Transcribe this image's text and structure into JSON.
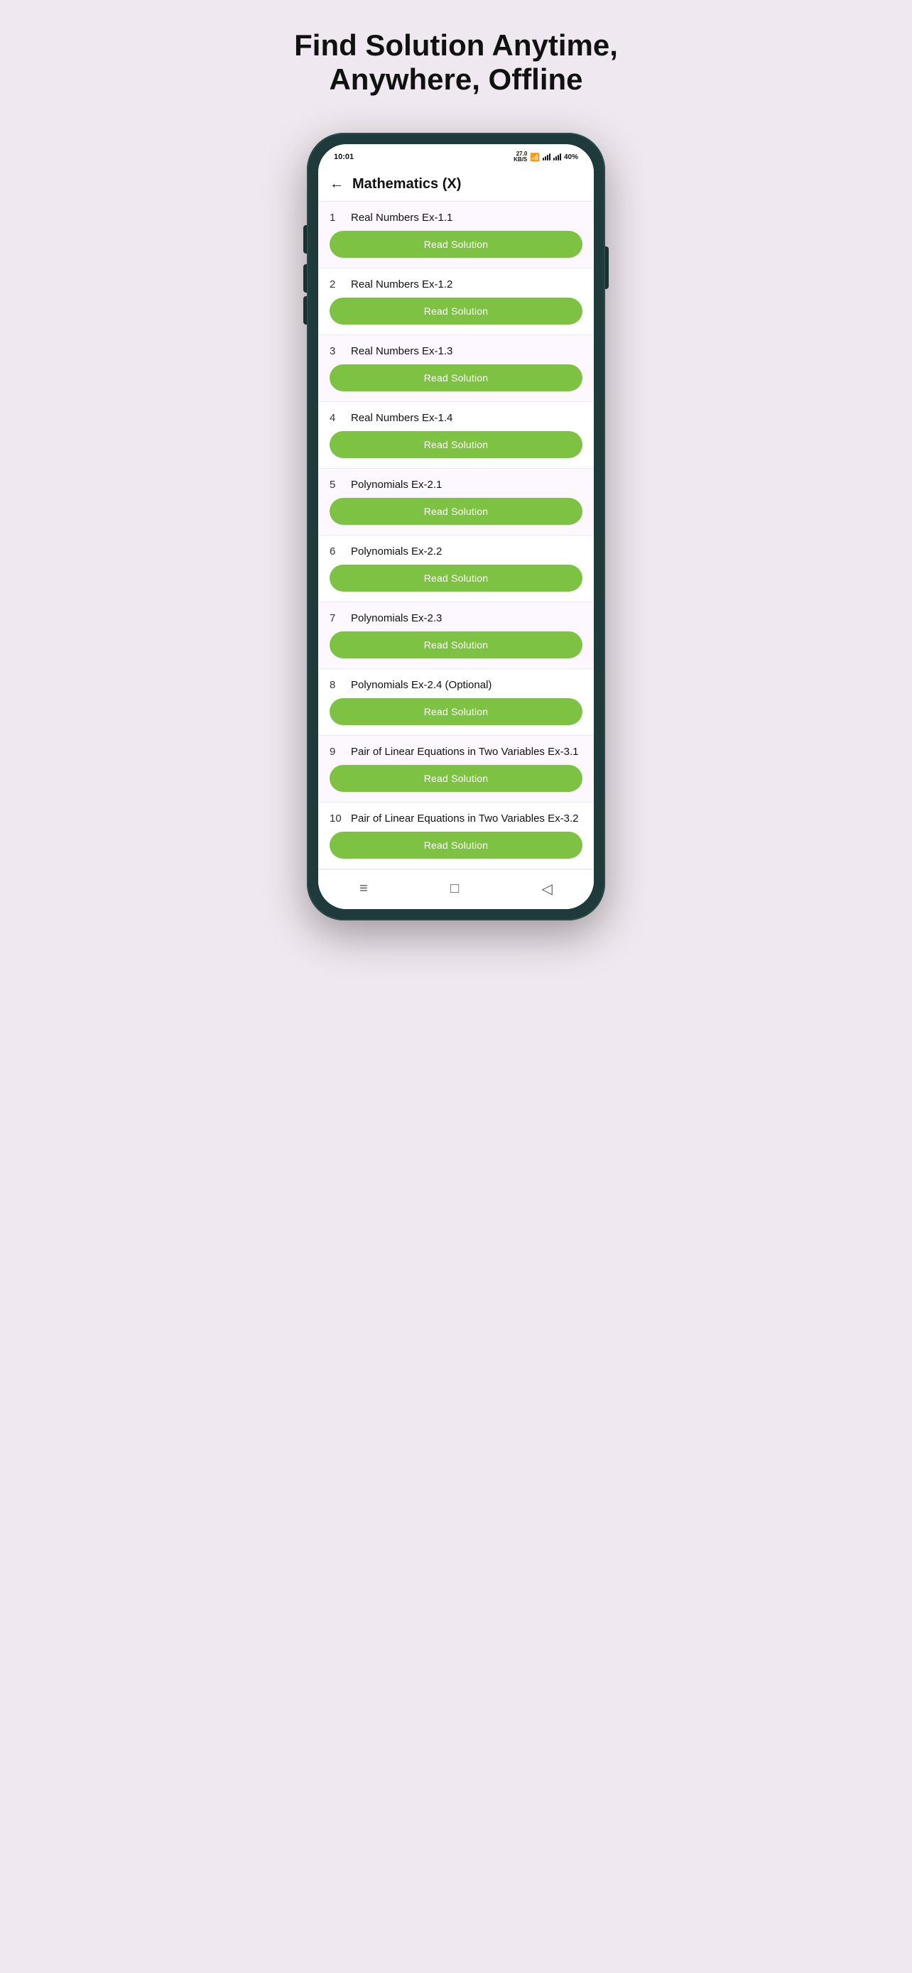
{
  "page": {
    "title_line1": "Find Solution Anytime,",
    "title_line2": "Anywhere, Offline"
  },
  "status_bar": {
    "time": "10:01",
    "kbs": "27.0\nKB/S",
    "battery": "40%"
  },
  "header": {
    "title": "Mathematics (X)"
  },
  "items": [
    {
      "number": "1",
      "name": "Real Numbers Ex-1.1",
      "btn": "Read Solution"
    },
    {
      "number": "2",
      "name": "Real Numbers Ex-1.2",
      "btn": "Read Solution"
    },
    {
      "number": "3",
      "name": "Real Numbers Ex-1.3",
      "btn": "Read Solution"
    },
    {
      "number": "4",
      "name": "Real Numbers Ex-1.4",
      "btn": "Read Solution"
    },
    {
      "number": "5",
      "name": "Polynomials Ex-2.1",
      "btn": "Read Solution"
    },
    {
      "number": "6",
      "name": "Polynomials Ex-2.2",
      "btn": "Read Solution"
    },
    {
      "number": "7",
      "name": "Polynomials Ex-2.3",
      "btn": "Read Solution"
    },
    {
      "number": "8",
      "name": "Polynomials Ex-2.4 (Optional)",
      "btn": "Read Solution"
    },
    {
      "number": "9",
      "name": "Pair of Linear Equations in Two Variables Ex-3.1",
      "btn": "Read Solution"
    },
    {
      "number": "10",
      "name": "Pair of Linear Equations in Two Variables Ex-3.2",
      "btn": "Read Solution"
    }
  ],
  "bottom_nav": {
    "menu_icon": "≡",
    "home_icon": "□",
    "back_icon": "◁"
  }
}
